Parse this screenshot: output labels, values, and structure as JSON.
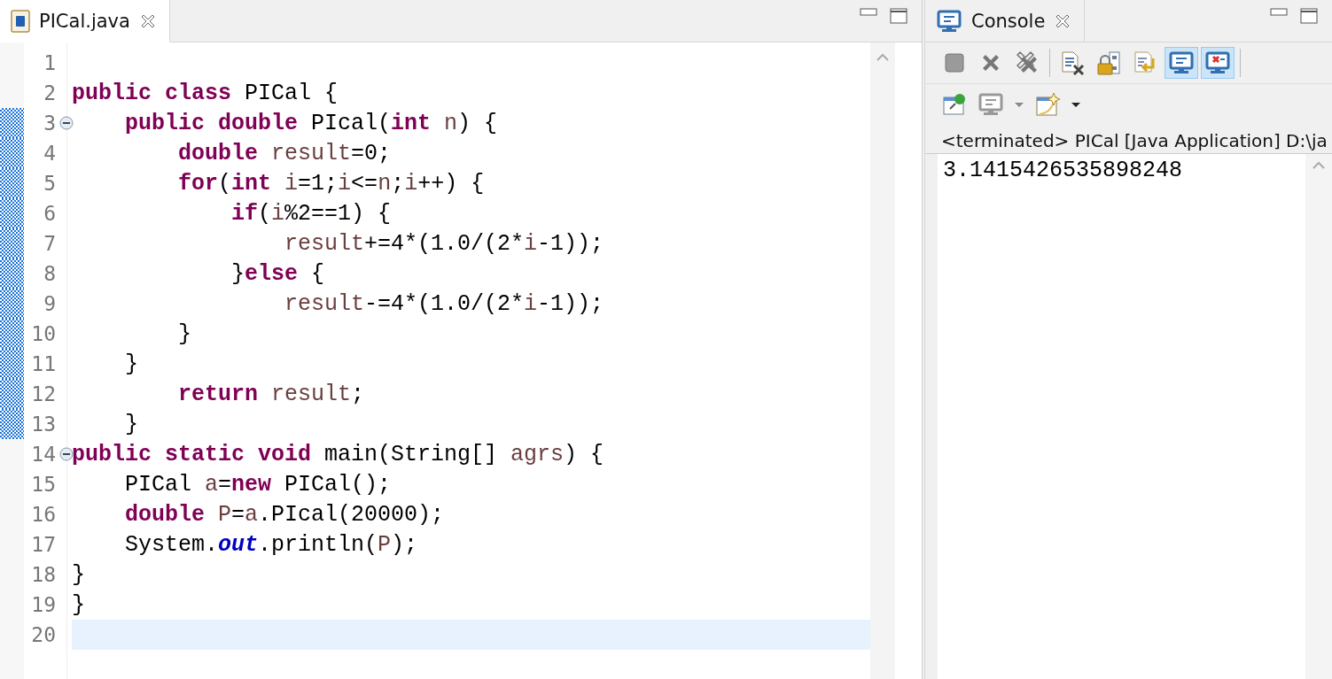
{
  "editor": {
    "tab": {
      "label": "PICal.java",
      "selected": true
    },
    "lines": [
      {
        "number": "1",
        "fold": false,
        "changed": false,
        "current": false
      },
      {
        "number": "2",
        "tokens": [
          {
            "text": "public class",
            "kind": "keyword"
          },
          {
            "text": " PICal {",
            "kind": "plain"
          }
        ],
        "fold": false,
        "changed": false,
        "current": false
      },
      {
        "number": "3",
        "tokens": [
          {
            "text": "    public double",
            "kind": "keyword"
          },
          {
            "text": " PIcal(",
            "kind": "plain"
          },
          {
            "text": "int",
            "kind": "keyword"
          },
          {
            "text": " n",
            "kind": "variable"
          },
          {
            "text": ") {",
            "kind": "plain"
          }
        ],
        "fold": true,
        "changed": true,
        "current": false
      },
      {
        "number": "4",
        "tokens": [
          {
            "text": "        double",
            "kind": "keyword"
          },
          {
            "text": " result",
            "kind": "variable"
          },
          {
            "text": "=0;",
            "kind": "plain"
          }
        ],
        "fold": false,
        "changed": true,
        "current": false
      },
      {
        "number": "5",
        "tokens": [
          {
            "text": "        for",
            "kind": "keyword"
          },
          {
            "text": "(",
            "kind": "plain"
          },
          {
            "text": "int",
            "kind": "keyword"
          },
          {
            "text": " i",
            "kind": "variable"
          },
          {
            "text": "=1;",
            "kind": "plain"
          },
          {
            "text": "i",
            "kind": "variable"
          },
          {
            "text": "<=",
            "kind": "plain"
          },
          {
            "text": "n",
            "kind": "variable"
          },
          {
            "text": ";",
            "kind": "plain"
          },
          {
            "text": "i",
            "kind": "variable"
          },
          {
            "text": "++) {",
            "kind": "plain"
          }
        ],
        "fold": false,
        "changed": true,
        "current": false
      },
      {
        "number": "6",
        "tokens": [
          {
            "text": "            if",
            "kind": "keyword"
          },
          {
            "text": "(",
            "kind": "plain"
          },
          {
            "text": "i",
            "kind": "variable"
          },
          {
            "text": "%2==1) {",
            "kind": "plain"
          }
        ],
        "fold": false,
        "changed": true,
        "current": false
      },
      {
        "number": "7",
        "tokens": [
          {
            "text": "                result",
            "kind": "variable"
          },
          {
            "text": "+=4*(1.0/(2*",
            "kind": "plain"
          },
          {
            "text": "i",
            "kind": "variable"
          },
          {
            "text": "-1));",
            "kind": "plain"
          }
        ],
        "fold": false,
        "changed": true,
        "current": false
      },
      {
        "number": "8",
        "tokens": [
          {
            "text": "            }",
            "kind": "plain"
          },
          {
            "text": "else",
            "kind": "keyword"
          },
          {
            "text": " {",
            "kind": "plain"
          }
        ],
        "fold": false,
        "changed": true,
        "current": false
      },
      {
        "number": "9",
        "tokens": [
          {
            "text": "                result",
            "kind": "variable"
          },
          {
            "text": "-=4*(1.0/(2*",
            "kind": "plain"
          },
          {
            "text": "i",
            "kind": "variable"
          },
          {
            "text": "-1));",
            "kind": "plain"
          }
        ],
        "fold": false,
        "changed": true,
        "current": false
      },
      {
        "number": "10",
        "tokens": [
          {
            "text": "        }",
            "kind": "plain"
          }
        ],
        "fold": false,
        "changed": true,
        "current": false
      },
      {
        "number": "11",
        "tokens": [
          {
            "text": "    }",
            "kind": "plain"
          }
        ],
        "fold": false,
        "changed": true,
        "current": false
      },
      {
        "number": "12",
        "tokens": [
          {
            "text": "        return",
            "kind": "keyword"
          },
          {
            "text": " result",
            "kind": "variable"
          },
          {
            "text": ";",
            "kind": "plain"
          }
        ],
        "fold": false,
        "changed": true,
        "current": false
      },
      {
        "number": "13",
        "tokens": [
          {
            "text": "    }",
            "kind": "plain"
          }
        ],
        "fold": false,
        "changed": true,
        "current": false
      },
      {
        "number": "14",
        "tokens": [
          {
            "text": "public static void",
            "kind": "keyword"
          },
          {
            "text": " main(String[] ",
            "kind": "plain"
          },
          {
            "text": "agrs",
            "kind": "variable"
          },
          {
            "text": ") {",
            "kind": "plain"
          }
        ],
        "fold": true,
        "changed": false,
        "current": false
      },
      {
        "number": "15",
        "tokens": [
          {
            "text": "    PICal ",
            "kind": "plain"
          },
          {
            "text": "a",
            "kind": "variable"
          },
          {
            "text": "=",
            "kind": "plain"
          },
          {
            "text": "new",
            "kind": "keyword"
          },
          {
            "text": " PICal();",
            "kind": "plain"
          }
        ],
        "fold": false,
        "changed": false,
        "current": false
      },
      {
        "number": "16",
        "tokens": [
          {
            "text": "    double",
            "kind": "keyword"
          },
          {
            "text": " P",
            "kind": "variable"
          },
          {
            "text": "=",
            "kind": "plain"
          },
          {
            "text": "a",
            "kind": "variable"
          },
          {
            "text": ".PIcal(20000);",
            "kind": "plain"
          }
        ],
        "fold": false,
        "changed": false,
        "current": false
      },
      {
        "number": "17",
        "tokens": [
          {
            "text": "    System.",
            "kind": "plain"
          },
          {
            "text": "out",
            "kind": "static"
          },
          {
            "text": ".println(",
            "kind": "plain"
          },
          {
            "text": "P",
            "kind": "variable"
          },
          {
            "text": ");",
            "kind": "plain"
          }
        ],
        "fold": false,
        "changed": false,
        "current": false
      },
      {
        "number": "18",
        "tokens": [
          {
            "text": "}",
            "kind": "plain"
          }
        ],
        "fold": false,
        "changed": false,
        "current": false
      },
      {
        "number": "19",
        "tokens": [
          {
            "text": "}",
            "kind": "plain"
          }
        ],
        "fold": false,
        "changed": false,
        "current": false
      },
      {
        "number": "20",
        "fold": false,
        "changed": false,
        "current": true
      }
    ]
  },
  "console": {
    "tab": {
      "label": "Console",
      "selected": false
    },
    "toolbar_rows": [
      [
        {
          "kind": "stop",
          "pressed": false
        },
        {
          "kind": "remove",
          "pressed": false
        },
        {
          "kind": "remove-all",
          "pressed": false
        },
        {
          "kind": "separator"
        },
        {
          "kind": "clear",
          "pressed": false
        },
        {
          "kind": "scroll-lock",
          "pressed": false
        },
        {
          "kind": "word-wrap",
          "pressed": false
        },
        {
          "kind": "stdout",
          "pressed": true
        },
        {
          "kind": "stderr",
          "pressed": true
        },
        {
          "kind": "separator"
        }
      ],
      [
        {
          "kind": "pin",
          "pressed": false
        },
        {
          "kind": "display",
          "pressed": false
        },
        {
          "kind": "caret",
          "pressed": false
        },
        {
          "kind": "open",
          "pressed": false
        },
        {
          "kind": "caret-dark",
          "pressed": false
        }
      ]
    ],
    "process_label": "<terminated> PICal [Java Application] D:\\ja",
    "output": [
      "3.1415426535898248"
    ]
  }
}
